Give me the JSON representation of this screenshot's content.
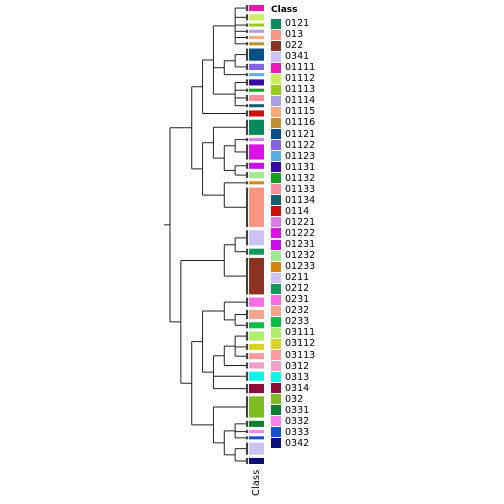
{
  "chart_data": {
    "type": "heatmap",
    "title": "",
    "annotation_column": "Class",
    "legend": {
      "title": "Class",
      "placement": "right",
      "entries": [
        {
          "label": "0121",
          "color": "#078A5B"
        },
        {
          "label": "013",
          "color": "#F99580"
        },
        {
          "label": "022",
          "color": "#8B3220"
        },
        {
          "label": "0341",
          "color": "#CFC2F5"
        },
        {
          "label": "01111",
          "color": "#EC18B5"
        },
        {
          "label": "01112",
          "color": "#CCEE5A"
        },
        {
          "label": "01113",
          "color": "#96CC1A"
        },
        {
          "label": "01114",
          "color": "#AE9FE0"
        },
        {
          "label": "01115",
          "color": "#FFA97A"
        },
        {
          "label": "01116",
          "color": "#C18E2A"
        },
        {
          "label": "01121",
          "color": "#06508A"
        },
        {
          "label": "01122",
          "color": "#8262E5"
        },
        {
          "label": "01123",
          "color": "#5AADE0"
        },
        {
          "label": "01131",
          "color": "#3A0AA8"
        },
        {
          "label": "01132",
          "color": "#12A21E"
        },
        {
          "label": "01133",
          "color": "#F78E9E"
        },
        {
          "label": "01134",
          "color": "#156070"
        },
        {
          "label": "0114",
          "color": "#D10E0E"
        },
        {
          "label": "01221",
          "color": "#DA7DE6"
        },
        {
          "label": "01222",
          "color": "#DD10E6"
        },
        {
          "label": "01231",
          "color": "#C90EEC"
        },
        {
          "label": "01232",
          "color": "#9EEA8C"
        },
        {
          "label": "01233",
          "color": "#D9820C"
        },
        {
          "label": "0211",
          "color": "#CFC0F5"
        },
        {
          "label": "0212",
          "color": "#0D9A5C"
        },
        {
          "label": "0231",
          "color": "#FB6BE6"
        },
        {
          "label": "0232",
          "color": "#F4A58E"
        },
        {
          "label": "0233",
          "color": "#0DBE44"
        },
        {
          "label": "03111",
          "color": "#AFEE6B"
        },
        {
          "label": "03112",
          "color": "#D9D12A"
        },
        {
          "label": "03113",
          "color": "#FC9B9B"
        },
        {
          "label": "0312",
          "color": "#EFA1C8"
        },
        {
          "label": "0313",
          "color": "#0EF6EC"
        },
        {
          "label": "0314",
          "color": "#8E0A3A"
        },
        {
          "label": "032",
          "color": "#7DBB22"
        },
        {
          "label": "0331",
          "color": "#0B7F32"
        },
        {
          "label": "0332",
          "color": "#F784EC"
        },
        {
          "label": "0333",
          "color": "#1450D2"
        },
        {
          "label": "0342",
          "color": "#0A0E78"
        }
      ]
    },
    "rows": [
      {
        "class": "01111",
        "count": 2
      },
      {
        "class": "01112",
        "count": 2
      },
      {
        "class": "01113",
        "count": 1
      },
      {
        "class": "01114",
        "count": 1
      },
      {
        "class": "01115",
        "count": 1
      },
      {
        "class": "01116",
        "count": 1
      },
      {
        "class": "01121",
        "count": 4
      },
      {
        "class": "01122",
        "count": 2
      },
      {
        "class": "01123",
        "count": 1
      },
      {
        "class": "01131",
        "count": 2
      },
      {
        "class": "01132",
        "count": 1
      },
      {
        "class": "01133",
        "count": 2
      },
      {
        "class": "01134",
        "count": 1
      },
      {
        "class": "0114",
        "count": 2
      },
      {
        "class": "0121",
        "count": 5
      },
      {
        "class": "01221",
        "count": 1
      },
      {
        "class": "01222",
        "count": 5
      },
      {
        "class": "01231",
        "count": 2
      },
      {
        "class": "01232",
        "count": 2
      },
      {
        "class": "01233",
        "count": 1
      },
      {
        "class": "013",
        "count": 13
      },
      {
        "class": "0211",
        "count": 5
      },
      {
        "class": "0212",
        "count": 2
      },
      {
        "class": "022",
        "count": 12
      },
      {
        "class": "0231",
        "count": 3
      },
      {
        "class": "0232",
        "count": 3
      },
      {
        "class": "0233",
        "count": 2
      },
      {
        "class": "03111",
        "count": 3
      },
      {
        "class": "03112",
        "count": 2
      },
      {
        "class": "03113",
        "count": 2
      },
      {
        "class": "0312",
        "count": 2
      },
      {
        "class": "0313",
        "count": 3
      },
      {
        "class": "0314",
        "count": 3
      },
      {
        "class": "032",
        "count": 7
      },
      {
        "class": "0331",
        "count": 2
      },
      {
        "class": "0332",
        "count": 1
      },
      {
        "class": "0333",
        "count": 1
      },
      {
        "class": "0341",
        "count": 4
      },
      {
        "class": "0342",
        "count": 2
      }
    ],
    "dendrogram": {
      "orientation": "left",
      "tree": [
        [
          [
            [
              [
                "01111",
                "01112",
                "01113",
                "01114",
                "01115",
                "01116"
              ],
              [
                [
                  "01121",
                  "01122"
                ],
                "01123"
              ],
              [
                "01131",
                "01132",
                "01133",
                "01134"
              ]
            ],
            "0114"
          ],
          [
            [
              "0121",
              [
                [
                  "01221",
                  "01222"
                ],
                [
                  "01231",
                  "01232"
                ]
              ]
            ],
            [
              [
                "01233"
              ],
              "013"
            ]
          ]
        ],
        [
          [
            [
              "0211",
              "0212"
            ],
            "022"
          ],
          [
            [
              [
                "0231",
                [
                  "0232",
                  "0233"
                ]
              ],
              [
                [
                  [
                    "03111",
                    "03112",
                    "03113"
                  ],
                  "0312"
                ],
                "0313",
                "0314"
              ]
            ],
            [
              "032",
              [
                [
                  "0331",
                  "0332",
                  "0333"
                ],
                [
                  "0341",
                  "0342"
                ]
              ]
            ]
          ]
        ]
      ]
    }
  }
}
